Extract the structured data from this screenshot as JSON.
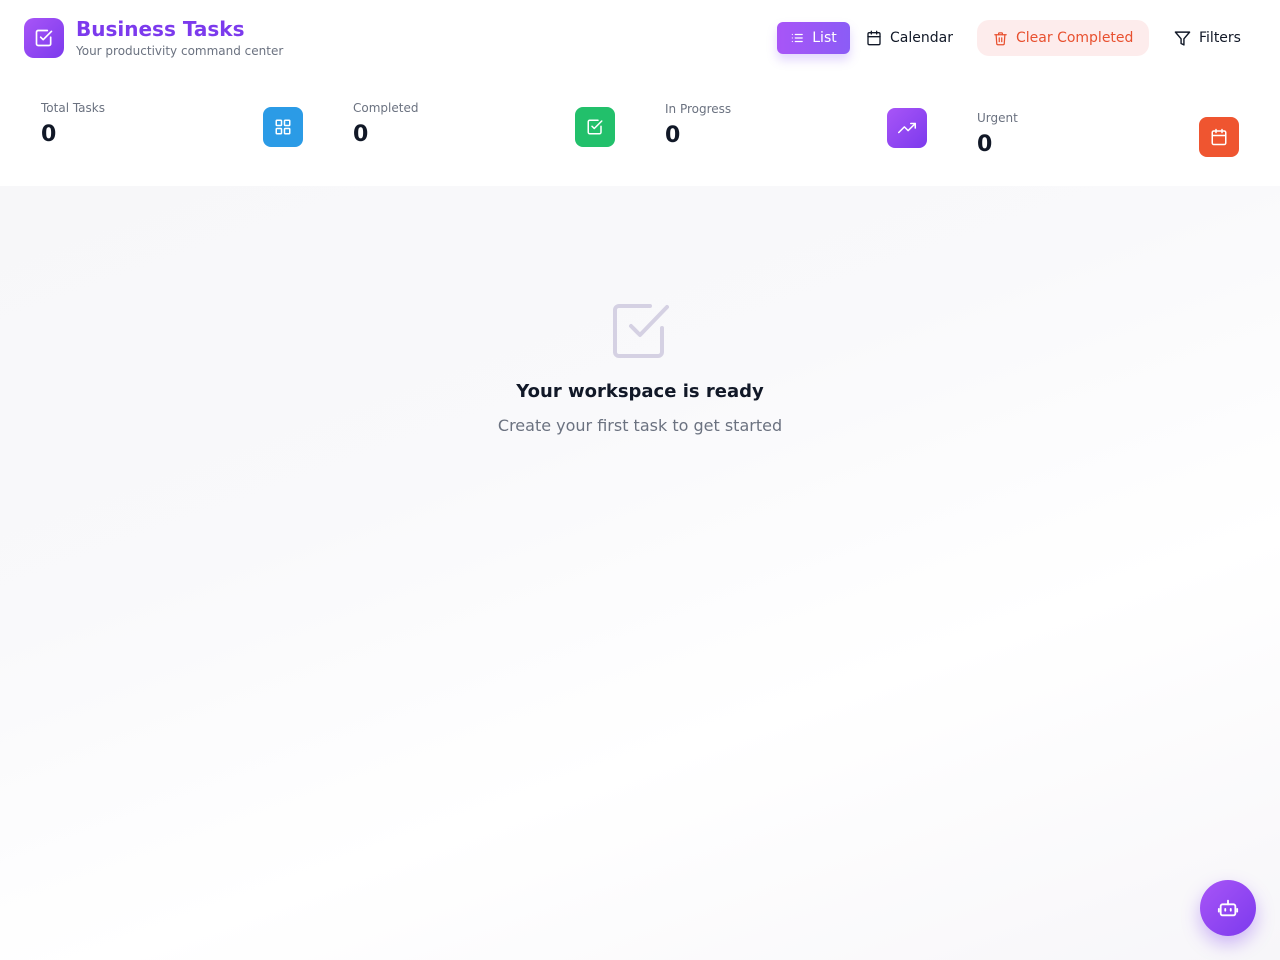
{
  "app": {
    "title": "Business Tasks",
    "subtitle": "Your productivity command center",
    "logo_icon": "check-square-icon",
    "accent_color": "#7c3aed"
  },
  "toolbar": {
    "list_label": "List",
    "list_icon": "list-icon",
    "calendar_label": "Calendar",
    "calendar_icon": "calendar-icon",
    "clear_label": "Clear Completed",
    "clear_icon": "trash-icon",
    "filters_label": "Filters",
    "filters_icon": "filter-icon",
    "active_view": "List"
  },
  "stats": [
    {
      "label": "Total Tasks",
      "value": "0",
      "icon": "grid-icon",
      "color": "#2b9be6"
    },
    {
      "label": "Completed",
      "value": "0",
      "icon": "check-square-icon",
      "color": "#22c06b"
    },
    {
      "label": "In Progress",
      "value": "0",
      "icon": "trending-up-icon",
      "color": "#8b5cf6"
    },
    {
      "label": "Urgent",
      "value": "0",
      "icon": "calendar-icon",
      "color": "#ef5530"
    }
  ],
  "empty_state": {
    "icon": "check-square-icon",
    "title": "Your workspace is ready",
    "subtitle": "Create your first task to get started"
  },
  "fab": {
    "icon": "bot-icon"
  }
}
